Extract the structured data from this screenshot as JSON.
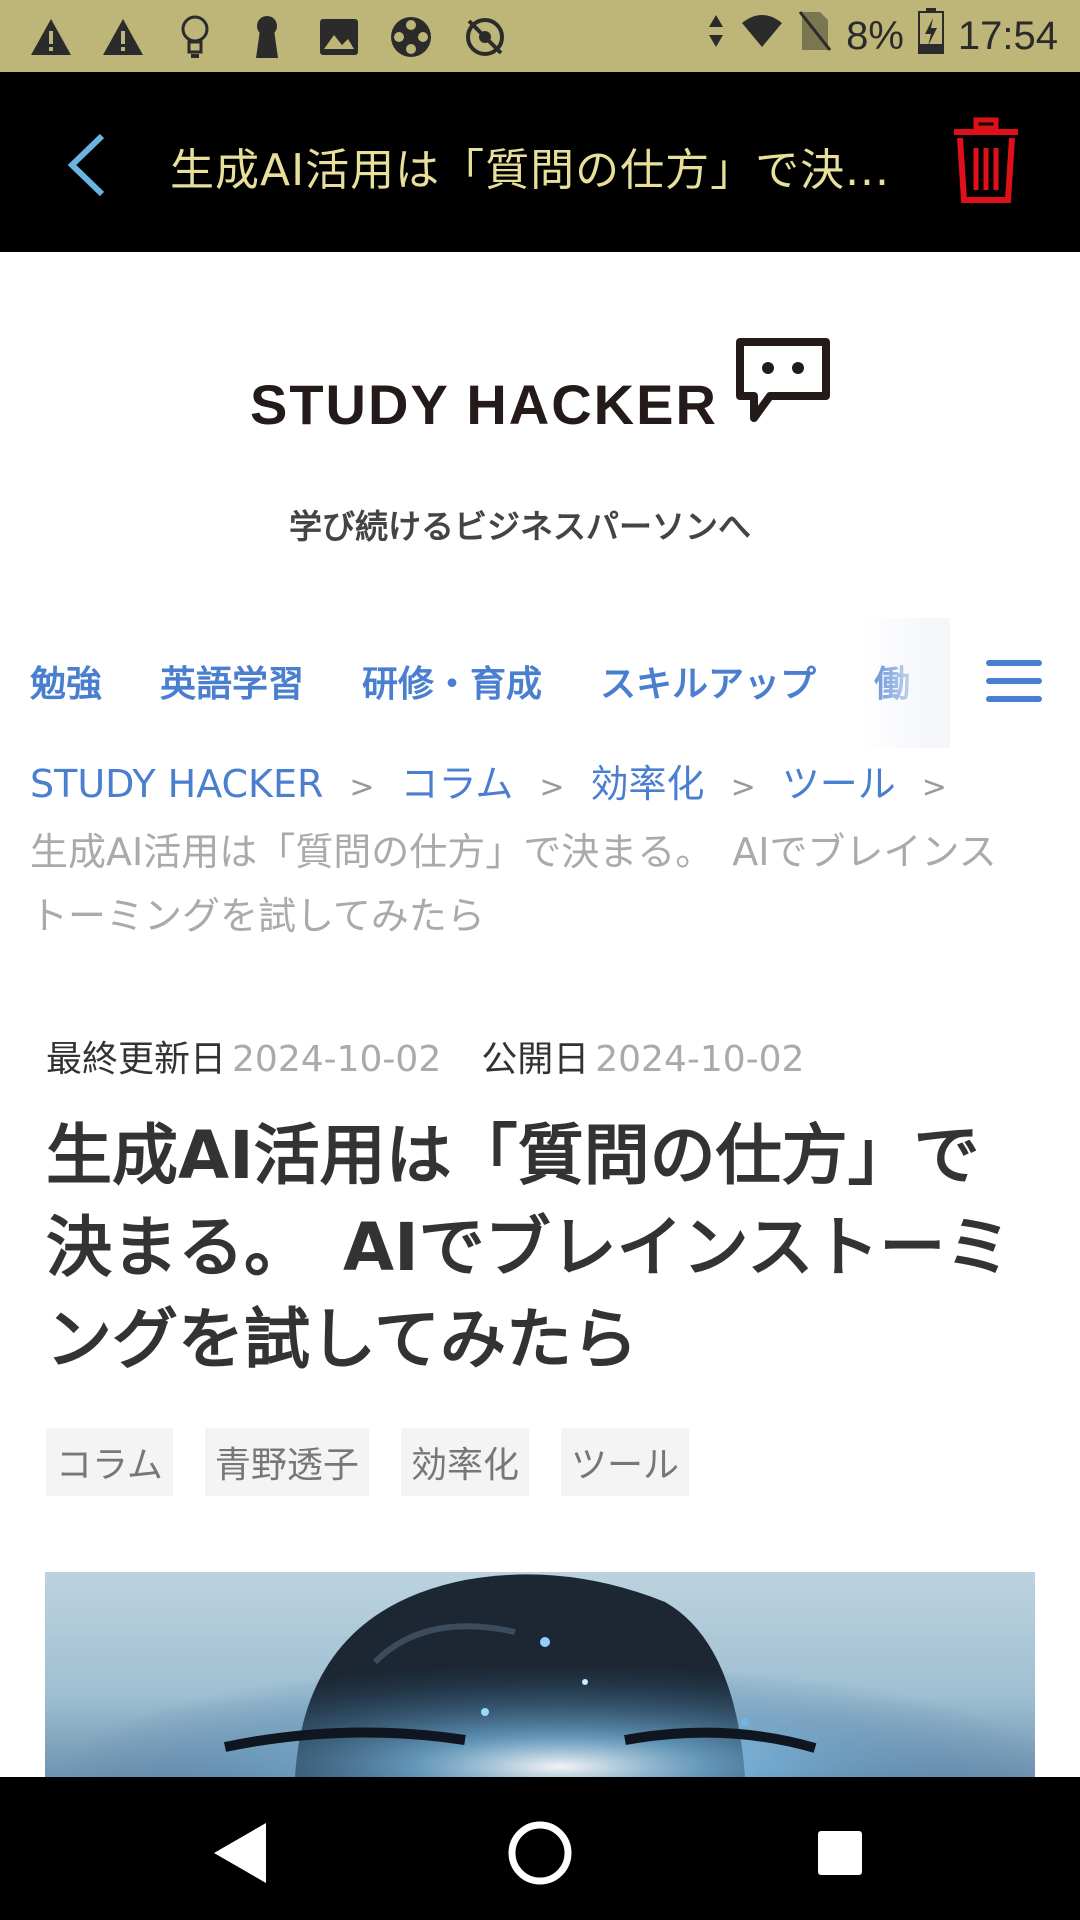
{
  "status_bar": {
    "battery": "8%",
    "time": "17:54",
    "icons": [
      "warning-icon",
      "warning-icon",
      "lightbulb-icon",
      "keyhole-icon",
      "image-icon",
      "film-reel-icon",
      "no-sync-icon",
      "data-arrows-icon",
      "wifi-icon",
      "no-sim-icon",
      "battery-charging-icon"
    ]
  },
  "app_bar": {
    "title": "生成AI活用は「質問の仕方」で決...",
    "back_icon": "chevron-left-icon",
    "delete_icon": "trash-icon",
    "accent": "#e8df9b",
    "delete_color": "#e0101a"
  },
  "site": {
    "logo_text": "STUDY HACKER",
    "tagline": "学び続けるビジネスパーソンへ"
  },
  "nav": {
    "items": [
      "勉強",
      "英語学習",
      "研修・育成",
      "スキルアップ",
      "働"
    ],
    "menu_icon": "hamburger-menu-icon",
    "link_color": "#4a7fd0"
  },
  "breadcrumb": {
    "links": [
      "STUDY HACKER",
      "コラム",
      "効率化",
      "ツール"
    ],
    "separator": ">",
    "current": "生成AI活用は「質問の仕方」で決まる。　AIでブレインストーミングを試してみたら"
  },
  "article": {
    "updated_label": "最終更新日",
    "updated_date": "2024-10-02",
    "published_label": "公開日",
    "published_date": "2024-10-02",
    "title": "生成AI活用は「質問の仕方」で決まる。　AIでブレインストーミングを試してみたら",
    "tags": [
      "コラム",
      "青野透子",
      "効率化",
      "ツール"
    ]
  },
  "system_nav": {
    "icons": [
      "back-triangle-icon",
      "home-circle-icon",
      "recents-square-icon"
    ]
  }
}
